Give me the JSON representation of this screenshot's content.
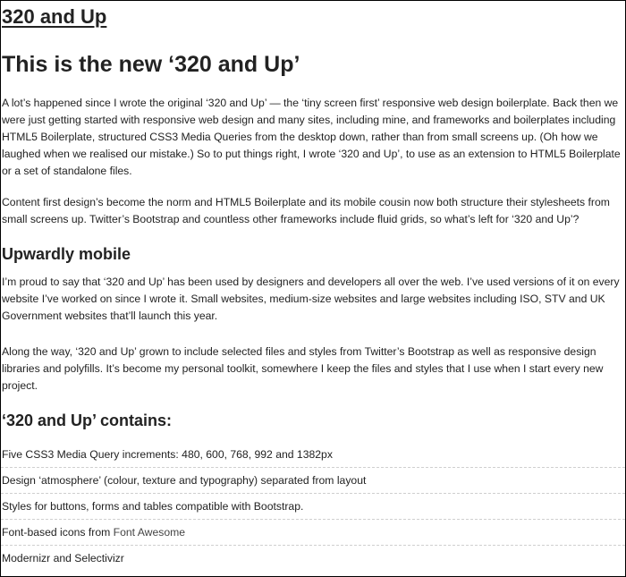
{
  "site": {
    "title": "320 and Up"
  },
  "article": {
    "heading": "This is the new ‘320 and Up’",
    "intro_1": "A lot’s happened since I wrote the original ‘320 and Up’ — the ‘tiny screen first’ responsive web design boilerplate. Back then we were just getting started with responsive web design and many sites, including mine, and frameworks and boilerplates including HTML5 Boilerplate, structured CSS3 Media Queries from the desktop down, rather than from small screens up. (Oh how we laughed when we realised our mistake.) So to put things right, I wrote ‘320 and Up’, to use as an extension to HTML5 Boilerplate or a set of standalone files.",
    "intro_2": "Content first design’s become the norm and HTML5 Boilerplate and its mobile cousin now both structure their stylesheets from small screens up. Twitter’s Bootstrap and countless other frameworks include fluid grids, so what’s left for ‘320 and Up’?",
    "section_1": {
      "heading": "Upwardly mobile",
      "para_1": "I’m proud to say that ‘320 and Up’ has been used by designers and developers all over the web. I’ve used versions of it on every website I’ve worked on since I wrote it. Small websites, medium-size websites and large websites including ISO, STV and UK Government websites that’ll launch this year.",
      "para_2": "Along the way, ‘320 and Up’ grown to include selected files and styles from Twitter’s Bootstrap as well as responsive design libraries and polyfills. It’s become my personal toolkit, somewhere I keep the files and styles that I use when I start every new project."
    },
    "section_2": {
      "heading": "‘320 and Up’ contains:",
      "items": [
        {
          "text": "Five CSS3 Media Query increments: 480, 600, 768, 992 and 1382px"
        },
        {
          "text": "Design ‘atmosphere’ (colour, texture and typography) separated from layout"
        },
        {
          "text": "Styles for buttons, forms and tables compatible with Bootstrap."
        },
        {
          "text": "Font-based icons from ",
          "link": "Font Awesome"
        },
        {
          "text": "Modernizr and Selectivizr"
        }
      ]
    }
  }
}
